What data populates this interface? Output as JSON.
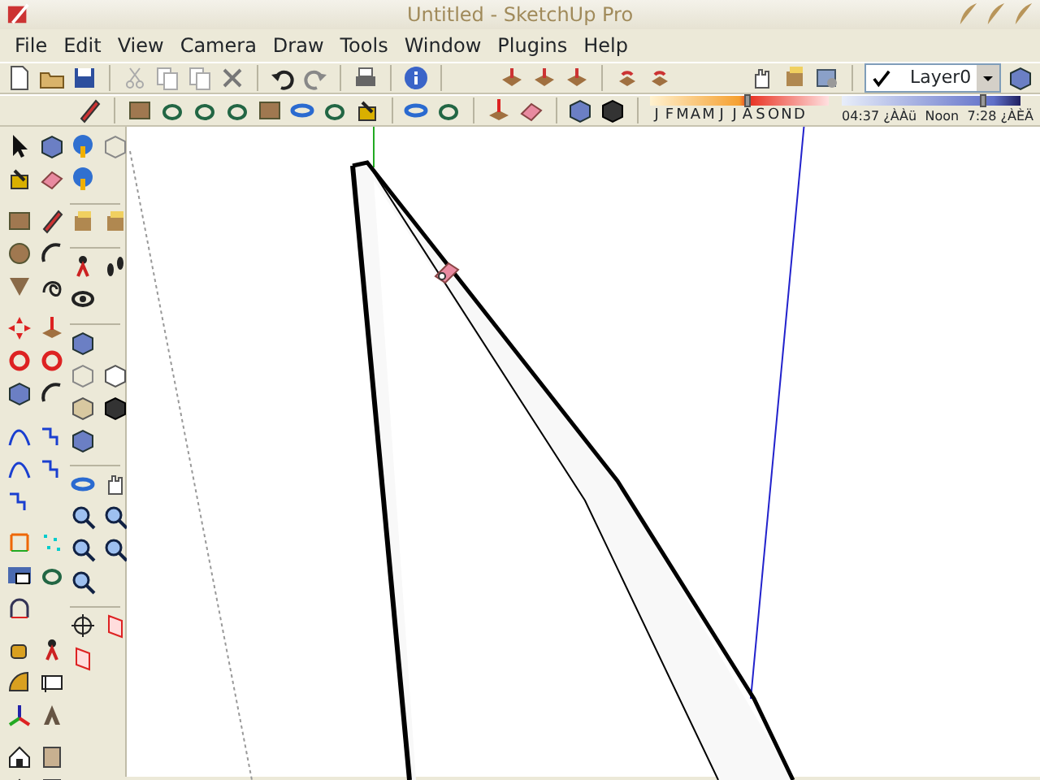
{
  "window": {
    "title": "Untitled - SketchUp Pro"
  },
  "menu": [
    {
      "label": "File"
    },
    {
      "label": "Edit"
    },
    {
      "label": "View"
    },
    {
      "label": "Camera"
    },
    {
      "label": "Draw"
    },
    {
      "label": "Tools"
    },
    {
      "label": "Window"
    },
    {
      "label": "Plugins"
    },
    {
      "label": "Help"
    }
  ],
  "layer": {
    "name": "Layer0",
    "current": true
  },
  "shadow": {
    "months": [
      "J",
      "F",
      "M",
      "A",
      "M",
      "J",
      "J",
      "A",
      "S",
      "O",
      "N",
      "D"
    ],
    "month_slider": {
      "level": 0.55
    },
    "times": [
      "04:37 ¿ÀÀü",
      "Noon",
      "7:28 ¿ÀÈÄ"
    ],
    "time_slider": {
      "level": 0.8
    }
  }
}
